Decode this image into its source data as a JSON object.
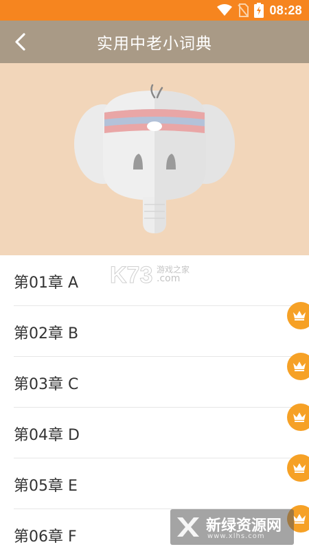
{
  "status_bar": {
    "time": "08:28",
    "icons": [
      "wifi-icon",
      "no-sim-icon",
      "battery-charging-icon"
    ],
    "color": "#f6851f"
  },
  "app_bar": {
    "title": "实用中老小词典",
    "back_icon": "back-arrow-icon",
    "color": "#a99a86"
  },
  "hero": {
    "illustration": "elephant-mascot",
    "background": "#f2d6ba"
  },
  "chapters": [
    {
      "label": "第01章 A",
      "locked": false
    },
    {
      "label": "第02章 B",
      "locked": true
    },
    {
      "label": "第03章 C",
      "locked": true
    },
    {
      "label": "第04章 D",
      "locked": true
    },
    {
      "label": "第05章 E",
      "locked": true
    },
    {
      "label": "第06章 F",
      "locked": true
    }
  ],
  "badge": {
    "icon": "crown-icon",
    "color": "#f6a126"
  },
  "watermarks": {
    "k73_logo": "K73",
    "k73_sub1": "游戏之家",
    "k73_sub2": ".com",
    "xinlv_name": "新绿资源网",
    "xinlv_url": "www.xlhs.com"
  }
}
